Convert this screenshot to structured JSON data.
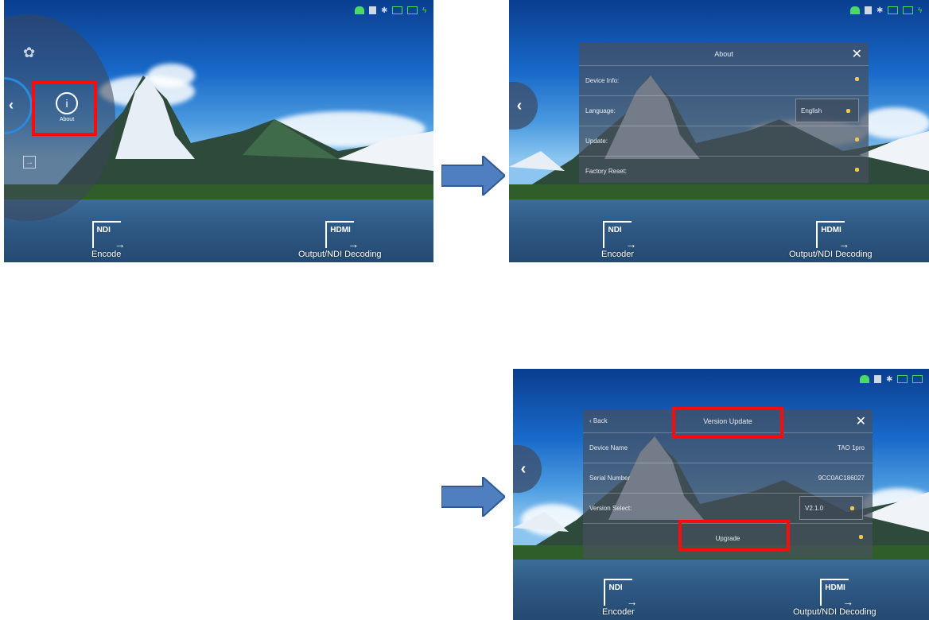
{
  "panel1": {
    "menu_about_label": "About",
    "tiles": [
      {
        "icon_text": "NDI",
        "label": "Encode"
      },
      {
        "icon_text": "HDMI",
        "label": "Output/NDI Decoding"
      }
    ]
  },
  "panel2": {
    "dialog_title": "About",
    "rows": [
      {
        "label": "Device Info:"
      },
      {
        "label": "Language:",
        "select_value": "English"
      },
      {
        "label": "Update:"
      },
      {
        "label": "Factory Reset:"
      }
    ],
    "tiles": [
      {
        "icon_text": "NDI",
        "label": "Encoder"
      },
      {
        "icon_text": "HDMI",
        "label": "Output/NDI Decoding"
      }
    ]
  },
  "panel3": {
    "back_label": "Back",
    "dialog_title": "Version  Update",
    "rows": [
      {
        "label": "Device Name",
        "value": "TAO 1pro"
      },
      {
        "label": "Serial Number",
        "value": "9CC0AC186027"
      },
      {
        "label": "Version Select:",
        "select_value": "V2.1.0"
      }
    ],
    "upgrade_label": "Upgrade",
    "tiles": [
      {
        "icon_text": "NDI",
        "label": "Encoder"
      },
      {
        "icon_text": "HDMI",
        "label": "Output/NDI Decoding"
      }
    ]
  },
  "colors": {
    "highlight": "#ff0a0a",
    "flow_arrow": "#4f7fc0",
    "status_green": "#4cd964"
  },
  "icons": [
    "android-icon",
    "sim-icon",
    "bluetooth-icon",
    "battery-icon",
    "charging-icon",
    "info-icon",
    "fan-icon",
    "exit-icon",
    "chevron-left-icon",
    "close-icon"
  ]
}
